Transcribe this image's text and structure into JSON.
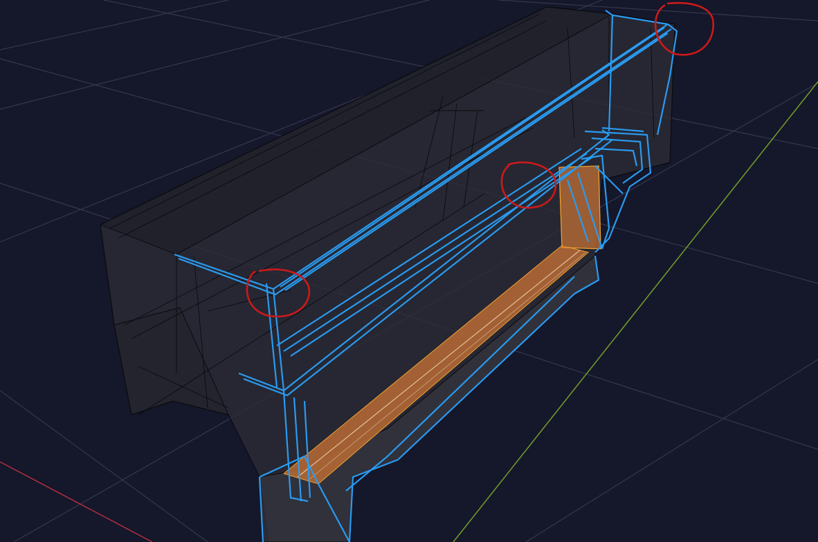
{
  "viewport": {
    "background": "#15172a",
    "grid_color": "#3a3d52",
    "x_axis_color": "#b03040",
    "y_axis_color": "#6f9a2a"
  },
  "model": {
    "shell_fill": "#2a2b33",
    "shell_edge": "#0b0b10",
    "selected_edge_color": "#2a9bf0",
    "active_face_color": "#b86b35",
    "active_face_edge": "#f0a030"
  },
  "annotations": {
    "color": "#cc1a1a",
    "count": 3
  }
}
